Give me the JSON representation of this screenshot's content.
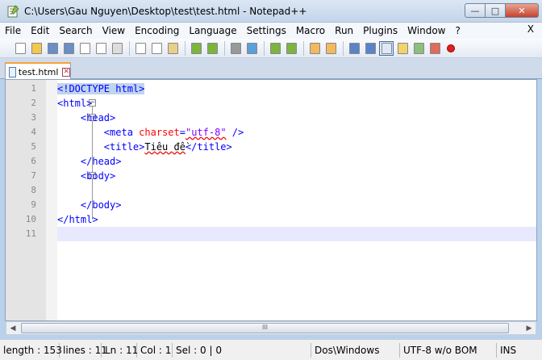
{
  "window": {
    "title": "C:\\Users\\Gau Nguyen\\Desktop\\test\\test.html - Notepad++"
  },
  "menu": {
    "items": [
      "File",
      "Edit",
      "Search",
      "View",
      "Encoding",
      "Language",
      "Settings",
      "Macro",
      "Run",
      "Plugins",
      "Window",
      "?"
    ],
    "close_label": "X"
  },
  "tab": {
    "label": "test.html"
  },
  "editor": {
    "line_numbers": [
      "1",
      "2",
      "3",
      "4",
      "5",
      "6",
      "7",
      "8",
      "9",
      "10",
      "11"
    ],
    "lines": [
      [
        {
          "t": "tag",
          "v": "<!DOCTYPE html>"
        }
      ],
      [
        {
          "t": "tag",
          "v": "<html>"
        }
      ],
      [
        {
          "t": "txt",
          "v": "    "
        },
        {
          "t": "tag",
          "v": "<head>"
        }
      ],
      [
        {
          "t": "txt",
          "v": "        "
        },
        {
          "t": "tag",
          "v": "<meta "
        },
        {
          "t": "attr",
          "v": "charset"
        },
        {
          "t": "tag",
          "v": "="
        },
        {
          "t": "str",
          "v": "\"utf-8\""
        },
        {
          "t": "tag",
          "v": " />"
        }
      ],
      [
        {
          "t": "txt",
          "v": "        "
        },
        {
          "t": "tag",
          "v": "<title>"
        },
        {
          "t": "txt",
          "v": "Tiêu đề"
        },
        {
          "t": "tag",
          "v": "</title>"
        }
      ],
      [
        {
          "t": "txt",
          "v": "    "
        },
        {
          "t": "tag",
          "v": "</head>"
        }
      ],
      [
        {
          "t": "txt",
          "v": "    "
        },
        {
          "t": "tag",
          "v": "<body>"
        }
      ],
      [],
      [
        {
          "t": "txt",
          "v": "    "
        },
        {
          "t": "tag",
          "v": "</body>"
        }
      ],
      [
        {
          "t": "tag",
          "v": "</html>"
        }
      ],
      []
    ],
    "current_line": 11
  },
  "status": {
    "length": "length : 153",
    "lines": "lines : 11",
    "ln": "Ln : 11",
    "col": "Col : 1",
    "sel": "Sel : 0 | 0",
    "eol": "Dos\\Windows",
    "encoding": "UTF-8 w/o BOM",
    "mode": "INS"
  },
  "scrollbar": {
    "thumb_grip": "III"
  },
  "colors": {
    "tag": "#0000ff",
    "attribute": "#ff0000",
    "string": "#8000ff",
    "current_line": "#e8e8ff",
    "tab_accent": "#f6a23a"
  },
  "toolbar_icons": [
    "new-icon",
    "open-icon",
    "save-icon",
    "save-all-icon",
    "close-icon",
    "close-all-icon",
    "print-icon",
    "cut-icon",
    "copy-icon",
    "paste-icon",
    "undo-icon",
    "redo-icon",
    "find-icon",
    "replace-icon",
    "zoom-in-icon",
    "zoom-out-icon",
    "sync-v-icon",
    "sync-h-icon",
    "wrap-icon",
    "show-all-chars-icon",
    "indent-guide-icon",
    "lang-icon",
    "doc-map-icon",
    "function-list-icon",
    "record-macro-icon"
  ]
}
